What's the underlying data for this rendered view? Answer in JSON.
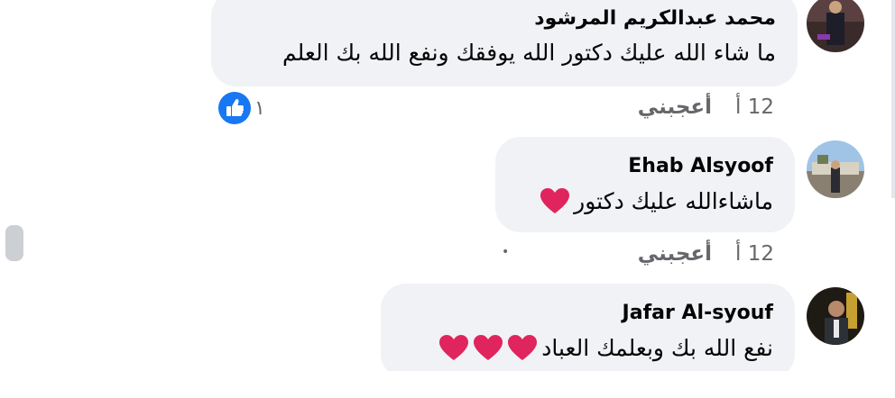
{
  "comments": [
    {
      "author": "محمد عبدالكريم المرشود",
      "text": "ما شاء الله عليك دكتور الله يوفقك ونفع الله بك العلم",
      "time": "12 أ",
      "like_label": "أعجبني",
      "reaction_count": "١",
      "reaction_icon": "like-thumb-icon"
    },
    {
      "author": "Ehab Alsyoof",
      "text": "ماشاءالله عليك دكتور",
      "emoji": "heart",
      "time": "12 أ",
      "like_label": "أعجبني",
      "separator": "•"
    },
    {
      "author": "Jafar Al-syouf",
      "text": "نفع الله بك وبعلمك العباد",
      "emoji": "heart x3"
    }
  ],
  "colors": {
    "bubble": "#f0f2f5",
    "meta_text": "#65676b",
    "like_blue": "#1877f2",
    "heart_red": "#e0245e"
  }
}
